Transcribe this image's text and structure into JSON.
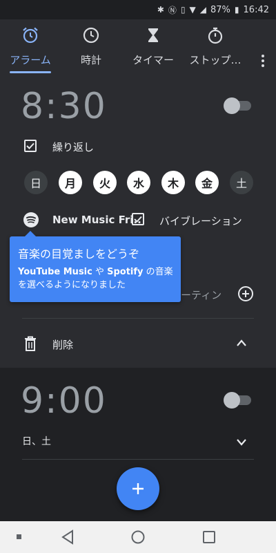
{
  "status_bar": {
    "battery": "87%",
    "time": "16:42"
  },
  "tabs": [
    {
      "label": "アラーム",
      "icon": "alarm-clock-icon",
      "active": true
    },
    {
      "label": "時計",
      "icon": "clock-icon",
      "active": false
    },
    {
      "label": "タイマー",
      "icon": "hourglass-icon",
      "active": false
    },
    {
      "label": "ストップ…",
      "icon": "stopwatch-icon",
      "active": false
    }
  ],
  "alarm1": {
    "time": "8:30",
    "repeat_label": "繰り返し",
    "days": [
      "日",
      "月",
      "火",
      "水",
      "木",
      "金",
      "土"
    ],
    "days_selected": [
      false,
      true,
      true,
      true,
      true,
      true,
      false
    ],
    "ringtone": "New Music Fri..",
    "vibration_label": "バイブレーション",
    "routine_label": "ーティン",
    "delete_label": "削除"
  },
  "tooltip": {
    "title": "音楽の目覚ましをどうぞ",
    "brand1": "YouTube Music",
    "text1": " や ",
    "brand2": "Spotify",
    "text2": " の音楽を選べるようになりました"
  },
  "alarm2": {
    "time": "9:00",
    "days_summary": "日、土"
  },
  "colors": {
    "accent": "#8ab4f8",
    "fab": "#4285f4",
    "background": "#202124",
    "card": "#2b2c30"
  }
}
